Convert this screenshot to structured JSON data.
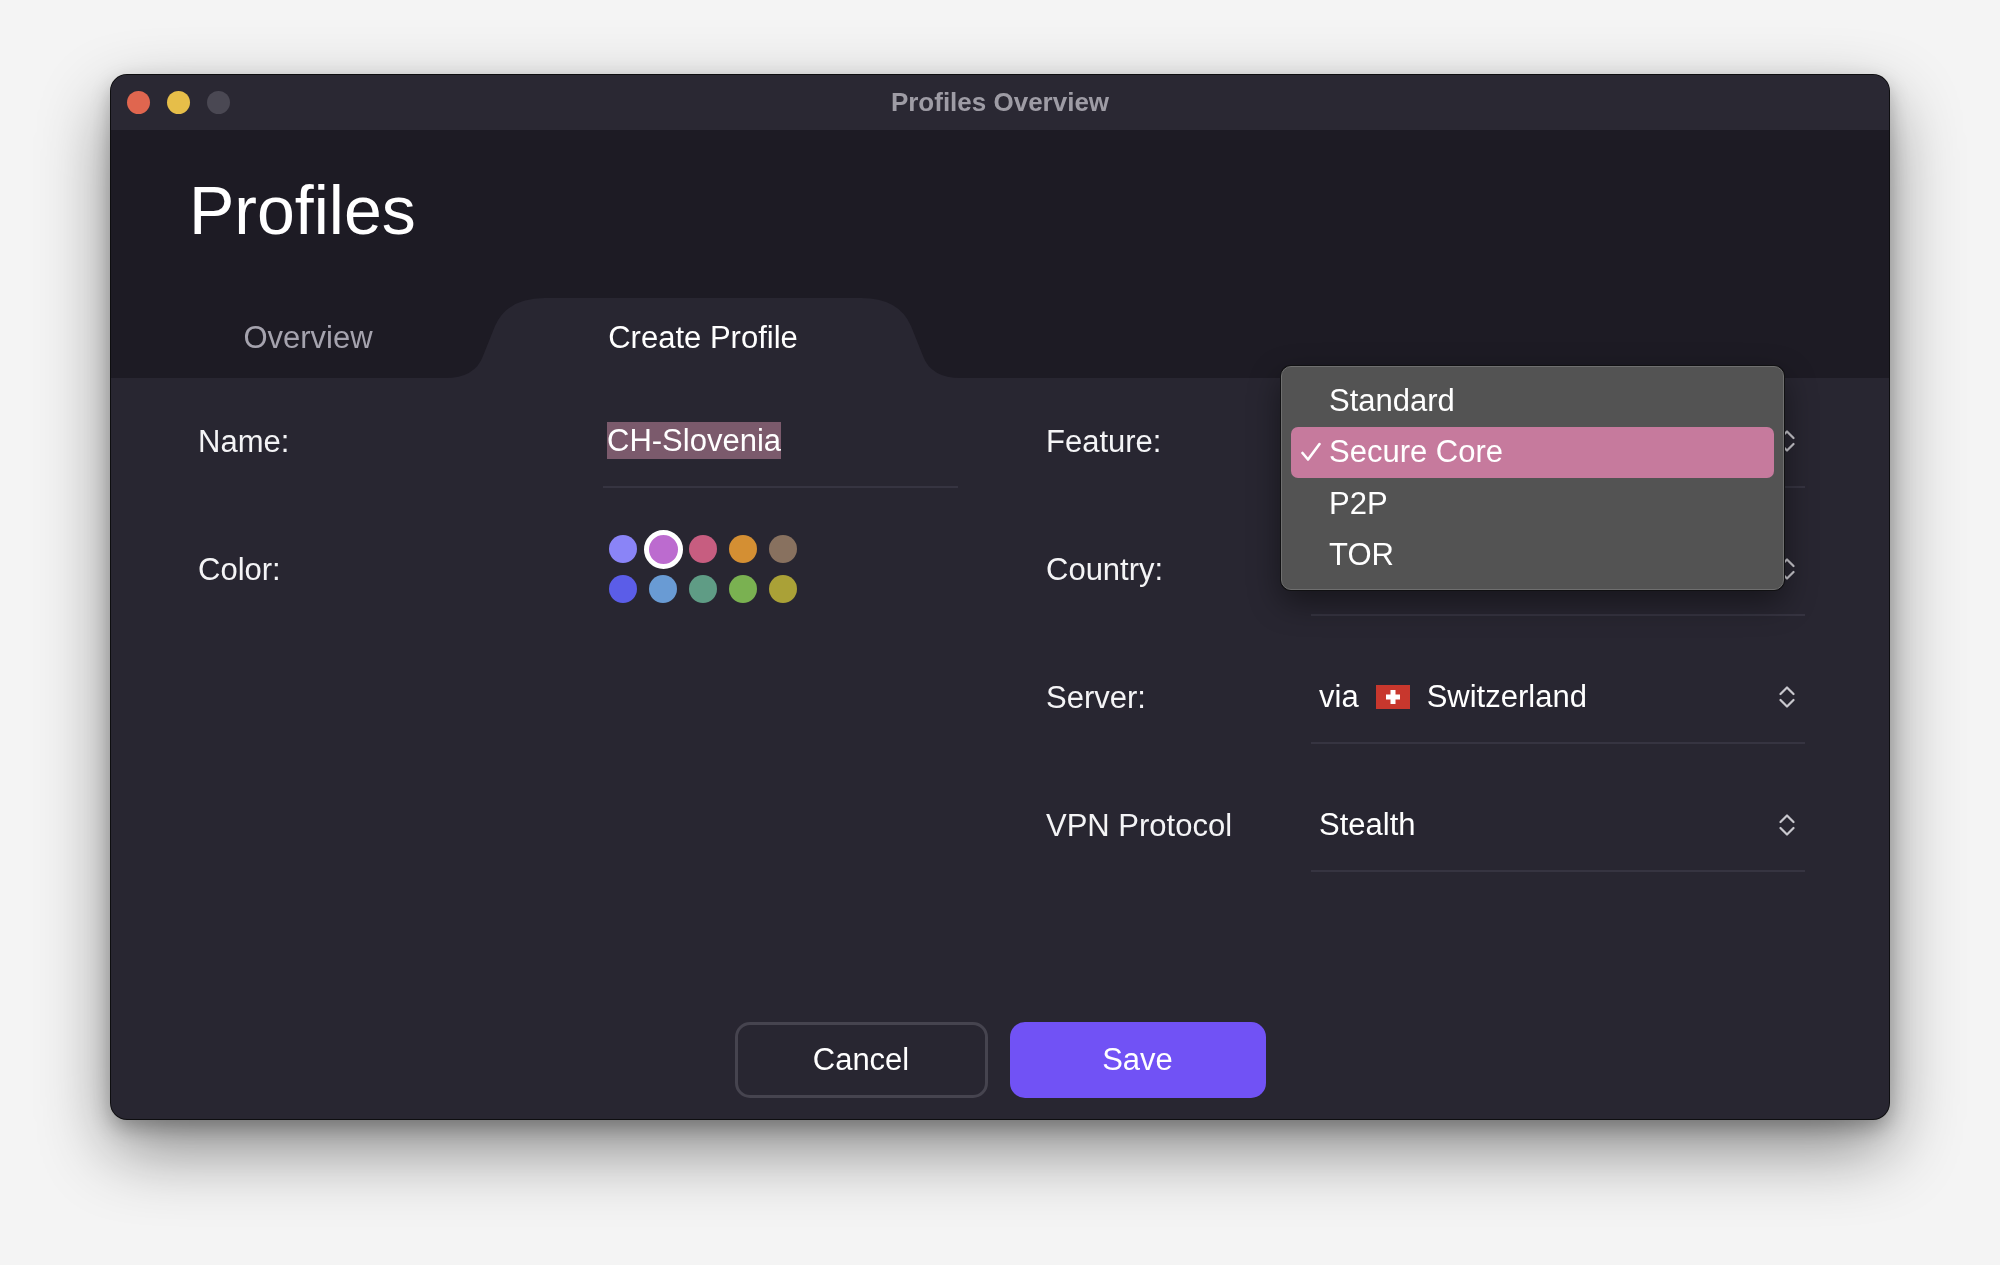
{
  "window": {
    "title": "Profiles Overview"
  },
  "header": {
    "title": "Profiles"
  },
  "tabs": [
    {
      "label": "Overview",
      "selected": false
    },
    {
      "label": "Create Profile",
      "selected": true
    }
  ],
  "form": {
    "left": [
      {
        "kind": "text",
        "label": "Name:",
        "value": "CH-Slovenia",
        "value_selected": true
      },
      {
        "kind": "colors",
        "label": "Color:",
        "swatches": [
          {
            "color": "#8a84f7",
            "selected": false
          },
          {
            "color": "#bc6bcf",
            "selected": true
          },
          {
            "color": "#c75d80",
            "selected": false
          },
          {
            "color": "#d48f33",
            "selected": false
          },
          {
            "color": "#88715f",
            "selected": false
          },
          {
            "color": "#5b5de8",
            "selected": false
          },
          {
            "color": "#699bd4",
            "selected": false
          },
          {
            "color": "#5f9c85",
            "selected": false
          },
          {
            "color": "#7ab151",
            "selected": false
          },
          {
            "color": "#aaa137",
            "selected": false
          }
        ]
      }
    ],
    "right": [
      {
        "kind": "select",
        "label": "Feature:",
        "menu": {
          "items": [
            {
              "label": "Standard",
              "selected": false
            },
            {
              "label": "Secure Core",
              "selected": true
            },
            {
              "label": "P2P",
              "selected": false
            },
            {
              "label": "TOR",
              "selected": false
            }
          ]
        }
      },
      {
        "kind": "select",
        "label": "Country:"
      },
      {
        "kind": "via_select",
        "label": "Server:",
        "prefix": "via",
        "value": "Switzerland"
      },
      {
        "kind": "select",
        "label": "VPN Protocol",
        "value": "Stealth"
      }
    ]
  },
  "buttons": [
    {
      "label": "Cancel",
      "kind": "secondary"
    },
    {
      "label": "Save",
      "kind": "primary"
    }
  ]
}
